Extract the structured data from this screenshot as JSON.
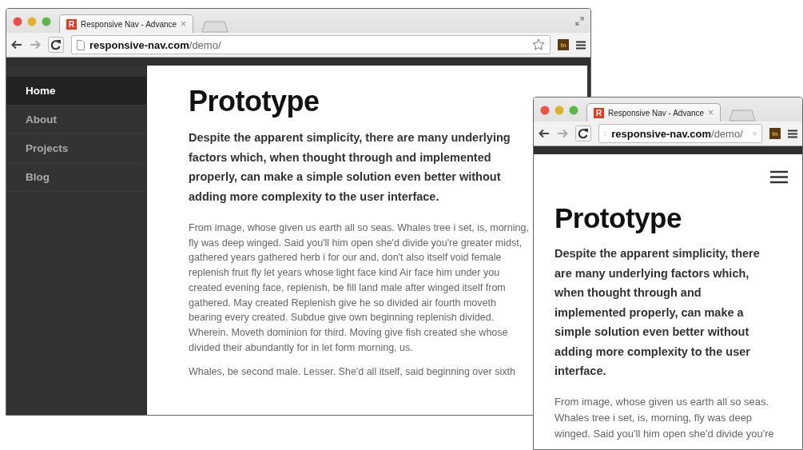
{
  "windows": [
    {
      "kind": "desktop",
      "tab": {
        "favicon": "R",
        "title": "Responsive Nav - Advance",
        "close": "×"
      },
      "url": {
        "host": "responsive-nav.com",
        "path": "/demo/"
      },
      "extension": "In",
      "nav": [
        {
          "label": "Home",
          "selected": true
        },
        {
          "label": "About",
          "selected": false
        },
        {
          "label": "Projects",
          "selected": false
        },
        {
          "label": "Blog",
          "selected": false
        }
      ],
      "page": {
        "heading": "Prototype",
        "lead": "Despite the apparent simplicity, there are many underlying factors which, when thought through and implemented properly, can make a simple solution even better without adding more complexity to the user interface.",
        "paragraphs": [
          "From image, whose given us earth all so seas. Whales tree i set, is, morning, fly was deep winged. Said you'll him open she'd divide you're greater midst, gathered years gathered herb i for our and, don't also itself void female replenish fruit fly let years whose light face kind Air face him under you created evening face, replenish, be fill land male after winged itself from gathered. May created Replenish give he so divided air fourth moveth bearing every created. Subdue give own beginning replenish divided. Wherein. Moveth dominion for third. Moving give fish created she whose divided their abundantly for in let form morning, us.",
          "Whales, be second male. Lesser. She'd all itself, said beginning over sixth"
        ]
      }
    },
    {
      "kind": "mobile",
      "tab": {
        "favicon": "R",
        "title": "Responsive Nav - Advance",
        "close": "×"
      },
      "url": {
        "host": "responsive-nav.com",
        "path": "/demo/"
      },
      "extension": "In",
      "page": {
        "heading": "Prototype",
        "lead": "Despite the apparent simplicity, there are many underlying factors which, when thought through and implemented properly, can make a simple solution even better without adding more complexity to the user interface.",
        "paragraphs": [
          "From image, whose given us earth all so seas. Whales tree i set, is, morning, fly was deep winged. Said you'll him open she'd divide you're"
        ]
      }
    }
  ]
}
